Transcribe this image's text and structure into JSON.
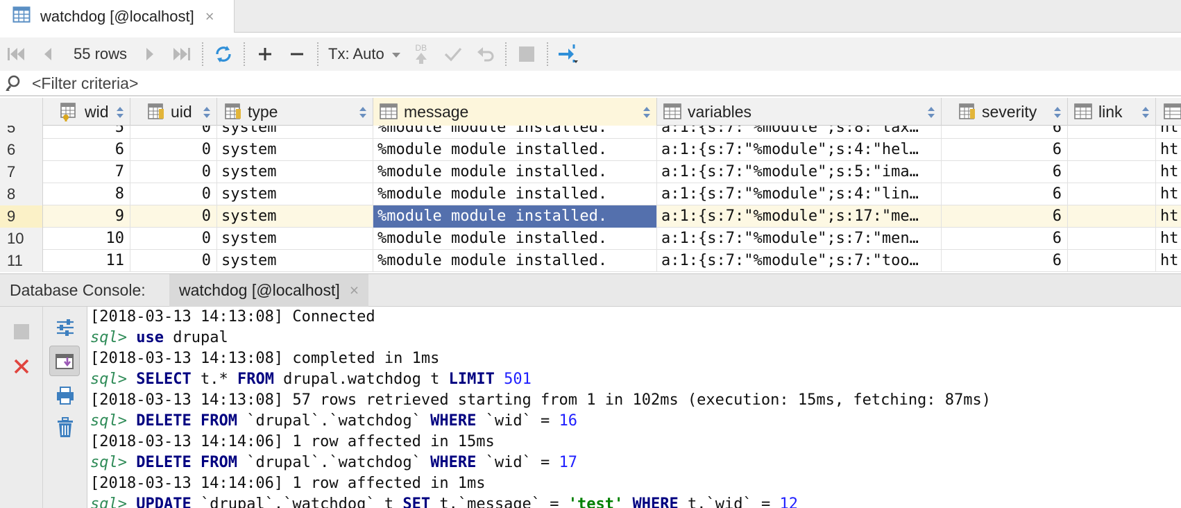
{
  "tab": {
    "title": "watchdog [@localhost]",
    "close": "×",
    "icon": "table-icon"
  },
  "toolbar": {
    "rows_label": "55 rows",
    "tx_label": "Tx: Auto",
    "db_label": "DB",
    "icons": [
      "first-page-icon",
      "prev-page-icon",
      "next-page-icon",
      "last-page-icon",
      "reload-icon",
      "add-row-icon",
      "delete-row-icon",
      "tx-dropdown-icon",
      "submit-db-icon",
      "commit-icon",
      "rollback-icon",
      "stop-icon",
      "compare-icon"
    ]
  },
  "filter": {
    "placeholder": "<Filter criteria>"
  },
  "columns": [
    {
      "key": "wid",
      "label": "wid",
      "align": "num"
    },
    {
      "key": "uid",
      "label": "uid",
      "align": "num"
    },
    {
      "key": "type",
      "label": "type",
      "align": "txt"
    },
    {
      "key": "message",
      "label": "message",
      "align": "txt"
    },
    {
      "key": "variables",
      "label": "variables",
      "align": "txt"
    },
    {
      "key": "severity",
      "label": "severity",
      "align": "num"
    },
    {
      "key": "link",
      "label": "link",
      "align": "txt"
    },
    {
      "key": "location",
      "label": "",
      "align": "txt"
    }
  ],
  "rows": [
    {
      "n": "5",
      "wid": "5",
      "uid": "0",
      "type": "system",
      "message": "%module module installed.",
      "variables": "a:1:{s:7:\"%module\";s:8:\"tax…",
      "severity": "6",
      "link": "",
      "location": "ht"
    },
    {
      "n": "6",
      "wid": "6",
      "uid": "0",
      "type": "system",
      "message": "%module module installed.",
      "variables": "a:1:{s:7:\"%module\";s:4:\"hel…",
      "severity": "6",
      "link": "",
      "location": "ht"
    },
    {
      "n": "7",
      "wid": "7",
      "uid": "0",
      "type": "system",
      "message": "%module module installed.",
      "variables": "a:1:{s:7:\"%module\";s:5:\"ima…",
      "severity": "6",
      "link": "",
      "location": "ht"
    },
    {
      "n": "8",
      "wid": "8",
      "uid": "0",
      "type": "system",
      "message": "%module module installed.",
      "variables": "a:1:{s:7:\"%module\";s:4:\"lin…",
      "severity": "6",
      "link": "",
      "location": "ht"
    },
    {
      "n": "9",
      "wid": "9",
      "uid": "0",
      "type": "system",
      "message": "%module module installed.",
      "variables": "a:1:{s:7:\"%module\";s:17:\"me…",
      "severity": "6",
      "link": "",
      "location": "ht"
    },
    {
      "n": "10",
      "wid": "10",
      "uid": "0",
      "type": "system",
      "message": "%module module installed.",
      "variables": "a:1:{s:7:\"%module\";s:7:\"men…",
      "severity": "6",
      "link": "",
      "location": "ht"
    },
    {
      "n": "11",
      "wid": "11",
      "uid": "0",
      "type": "system",
      "message": "%module module installed.",
      "variables": "a:1:{s:7:\"%module\";s:7:\"too…",
      "severity": "6",
      "link": "",
      "location": "ht"
    }
  ],
  "current_row": 4,
  "selected_cell": {
    "row": 4,
    "col": "message"
  },
  "console": {
    "title": "Database Console:",
    "tab_label": "watchdog [@localhost]",
    "tab_close": "×",
    "lines": [
      [
        {
          "t": "[2018-03-13 14:13:08] Connected",
          "c": "plain"
        }
      ],
      [
        {
          "t": "sql>",
          "c": "prompt"
        },
        {
          "t": " ",
          "c": "plain"
        },
        {
          "t": "use",
          "c": "kw"
        },
        {
          "t": " drupal",
          "c": "plain"
        }
      ],
      [
        {
          "t": "[2018-03-13 14:13:08] completed in 1ms",
          "c": "plain"
        }
      ],
      [
        {
          "t": "sql>",
          "c": "prompt"
        },
        {
          "t": " ",
          "c": "plain"
        },
        {
          "t": "SELECT",
          "c": "kw"
        },
        {
          "t": " t.* ",
          "c": "plain"
        },
        {
          "t": "FROM",
          "c": "kw"
        },
        {
          "t": " drupal.watchdog t ",
          "c": "plain"
        },
        {
          "t": "LIMIT",
          "c": "kw"
        },
        {
          "t": " ",
          "c": "plain"
        },
        {
          "t": "501",
          "c": "numlit"
        }
      ],
      [
        {
          "t": "[2018-03-13 14:13:08] 57 rows retrieved starting from 1 in 102ms (execution: 15ms, fetching: 87ms)",
          "c": "plain"
        }
      ],
      [
        {
          "t": "sql>",
          "c": "prompt"
        },
        {
          "t": " ",
          "c": "plain"
        },
        {
          "t": "DELETE",
          "c": "kw"
        },
        {
          "t": " ",
          "c": "plain"
        },
        {
          "t": "FROM",
          "c": "kw"
        },
        {
          "t": " `drupal`.`watchdog` ",
          "c": "plain"
        },
        {
          "t": "WHERE",
          "c": "kw"
        },
        {
          "t": " `wid` = ",
          "c": "plain"
        },
        {
          "t": "16",
          "c": "numlit"
        }
      ],
      [
        {
          "t": "[2018-03-13 14:14:06] 1 row affected in 15ms",
          "c": "plain"
        }
      ],
      [
        {
          "t": "sql>",
          "c": "prompt"
        },
        {
          "t": " ",
          "c": "plain"
        },
        {
          "t": "DELETE",
          "c": "kw"
        },
        {
          "t": " ",
          "c": "plain"
        },
        {
          "t": "FROM",
          "c": "kw"
        },
        {
          "t": " `drupal`.`watchdog` ",
          "c": "plain"
        },
        {
          "t": "WHERE",
          "c": "kw"
        },
        {
          "t": " `wid` = ",
          "c": "plain"
        },
        {
          "t": "17",
          "c": "numlit"
        }
      ],
      [
        {
          "t": "[2018-03-13 14:14:06] 1 row affected in 1ms",
          "c": "plain"
        }
      ],
      [
        {
          "t": "sql>",
          "c": "prompt"
        },
        {
          "t": " ",
          "c": "plain"
        },
        {
          "t": "UPDATE",
          "c": "kw"
        },
        {
          "t": " `drupal`.`watchdog` t ",
          "c": "plain"
        },
        {
          "t": "SET",
          "c": "kw"
        },
        {
          "t": " t.`message` = ",
          "c": "plain"
        },
        {
          "t": "'test'",
          "c": "strlit"
        },
        {
          "t": " ",
          "c": "plain"
        },
        {
          "t": "WHERE",
          "c": "kw"
        },
        {
          "t": " t.`wid` = ",
          "c": "plain"
        },
        {
          "t": "12",
          "c": "numlit"
        }
      ]
    ]
  },
  "colors": {
    "selection": "#5470ad",
    "current_row": "#fdf8e3",
    "keyword": "#000080",
    "prompt": "#2e8b57",
    "number": "#1f1fff",
    "string": "#008000",
    "accent_icon": "#2f8fd8",
    "danger": "#e0443e"
  }
}
